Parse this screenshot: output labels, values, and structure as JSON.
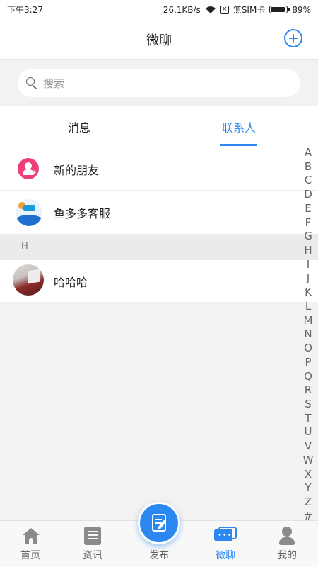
{
  "status_bar": {
    "time": "下午3:27",
    "network_speed": "26.1KB/s",
    "sim_status": "無SIM卡",
    "battery_percent": "89%",
    "battery_level": 0.89
  },
  "header": {
    "title": "微聊",
    "add_icon": "plus-circle-icon"
  },
  "search": {
    "placeholder": "搜索",
    "icon": "search-icon"
  },
  "tabs": [
    {
      "label": "消息",
      "active": false
    },
    {
      "label": "联系人",
      "active": true
    }
  ],
  "contacts": {
    "pinned": [
      {
        "name": "新的朋友",
        "icon": "new-friend-icon"
      },
      {
        "name": "鱼多多客服",
        "icon": "customer-service-logo"
      }
    ],
    "sections": [
      {
        "letter": "H",
        "items": [
          {
            "name": "哈哈哈",
            "icon": "user-photo-avatar"
          }
        ]
      }
    ]
  },
  "index_letters": [
    "A",
    "B",
    "C",
    "D",
    "E",
    "F",
    "G",
    "H",
    "I",
    "J",
    "K",
    "L",
    "M",
    "N",
    "O",
    "P",
    "Q",
    "R",
    "S",
    "T",
    "U",
    "V",
    "W",
    "X",
    "Y",
    "Z",
    "#"
  ],
  "bottom_nav": [
    {
      "label": "首页",
      "icon": "home-icon",
      "active": false
    },
    {
      "label": "资讯",
      "icon": "news-icon",
      "active": false
    },
    {
      "label": "发布",
      "icon": "publish-icon",
      "active": false
    },
    {
      "label": "微聊",
      "icon": "chat-icon",
      "active": true
    },
    {
      "label": "我的",
      "icon": "profile-icon",
      "active": false
    }
  ],
  "colors": {
    "accent": "#2b88f0",
    "new_friend_icon": "#ee4077",
    "text_primary": "#222222",
    "text_muted": "#999999"
  }
}
